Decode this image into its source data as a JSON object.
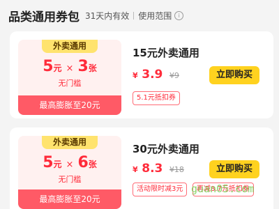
{
  "header": {
    "title": "品类通用券包",
    "validity": "31天内有效",
    "scope": "使用范围",
    "info_icon": "i"
  },
  "cards": [
    {
      "coupon": {
        "tag": "外卖通用",
        "amount": "5",
        "amount_unit": "元",
        "times": "×",
        "count": "3",
        "count_unit": "张",
        "condition": "无门槛",
        "footer": "最高膨胀至20元"
      },
      "title": "15元外卖通用",
      "currency": "¥",
      "price": "3.9",
      "original_price": "¥9",
      "buy_label": "立即购买",
      "tags": [
        "5.1元抵扣券"
      ]
    },
    {
      "coupon": {
        "tag": "外卖通用",
        "amount": "5",
        "amount_unit": "元",
        "times": "×",
        "count": "6",
        "count_unit": "张",
        "condition": "无门槛",
        "footer": "最高膨胀至20元"
      },
      "title": "30元外卖通用",
      "currency": "¥",
      "price": "8.3",
      "original_price": "¥18",
      "buy_label": "立即购买",
      "tags": [
        "活动限时减3元",
        "再减8.7元抵扣券"
      ]
    }
  ],
  "watermark": "guan05.com"
}
